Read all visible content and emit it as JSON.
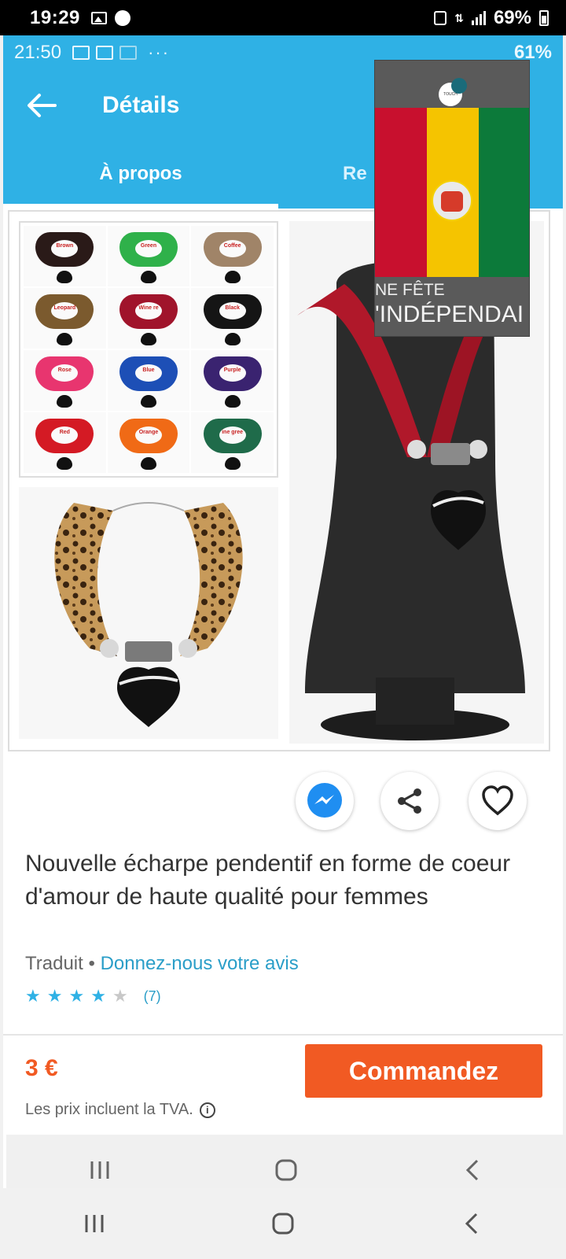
{
  "outer_status": {
    "time": "19:29",
    "battery": "69%"
  },
  "inner_status": {
    "time": "21:50",
    "more": "···",
    "battery": "61%"
  },
  "header": {
    "title": "Détails",
    "tabs": [
      "À propos",
      "Re"
    ]
  },
  "gallery": {
    "swatches": [
      {
        "label": "Brown",
        "color": "#2a1a18"
      },
      {
        "label": "Green",
        "color": "#2fb14a"
      },
      {
        "label": "Coffee",
        "color": "#a08468"
      },
      {
        "label": "Leopard",
        "color": "#7b5a2e"
      },
      {
        "label": "Wine re",
        "color": "#a0142b"
      },
      {
        "label": "Black",
        "color": "#151515"
      },
      {
        "label": "Rose",
        "color": "#e8356f"
      },
      {
        "label": "Blue",
        "color": "#1d4fb6"
      },
      {
        "label": "Purple",
        "color": "#3a2370"
      },
      {
        "label": "Red",
        "color": "#d41a24"
      },
      {
        "label": "Orange",
        "color": "#f06a16"
      },
      {
        "label": "ine gree",
        "color": "#1f6b4a"
      }
    ]
  },
  "overlay": {
    "badge": "TOUCH",
    "line1": "NE FÊTE",
    "line2": "'INDÉPENDAI",
    "flag_colors": [
      "#c8102e",
      "#f5c400",
      "#0c7a3a"
    ]
  },
  "product": {
    "title": "Nouvelle écharpe pendentif en forme de coeur d'amour de haute qualité pour femmes",
    "translated": "Traduit",
    "separator": "•",
    "feedback_link": "Donnez-nous votre avis",
    "rating": 4,
    "rating_max": 5,
    "rating_count": "(7)"
  },
  "purchase": {
    "price": "3 €",
    "vat_note": "Les prix incluent la TVA.",
    "order_label": "Commandez"
  },
  "colors": {
    "accent_blue": "#2fb1e5",
    "order_orange": "#f15a23",
    "link_blue": "#2a9ec8"
  }
}
